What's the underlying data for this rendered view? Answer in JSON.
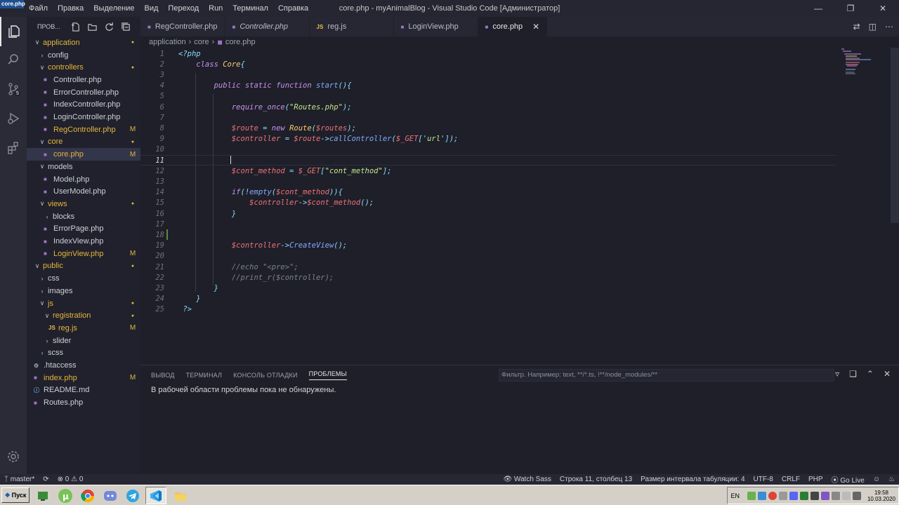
{
  "titlebar": {
    "badge": "core.php",
    "window_title": "core.php - myAnimalBlog - Visual Studio Code [Администратор]",
    "menu": [
      "Файл",
      "Правка",
      "Выделение",
      "Вид",
      "Переход",
      "Run",
      "Терминал",
      "Справка"
    ]
  },
  "sidebar": {
    "header": "ПРОВ...",
    "tree": [
      {
        "name": "application",
        "depth": 0,
        "chev": "v",
        "type": "folder",
        "status": "dot",
        "color": "mod"
      },
      {
        "name": "config",
        "depth": 1,
        "chev": ">",
        "type": "folder",
        "status": "",
        "color": "plain"
      },
      {
        "name": "controllers",
        "depth": 1,
        "chev": "v",
        "type": "folder",
        "status": "dot",
        "color": "mod"
      },
      {
        "name": "Controller.php",
        "depth": 2,
        "chev": "",
        "type": "php",
        "status": "",
        "color": "plain"
      },
      {
        "name": "ErrorController.php",
        "depth": 2,
        "chev": "",
        "type": "php",
        "status": "",
        "color": "plain"
      },
      {
        "name": "IndexController.php",
        "depth": 2,
        "chev": "",
        "type": "php",
        "status": "",
        "color": "plain"
      },
      {
        "name": "LoginController.php",
        "depth": 2,
        "chev": "",
        "type": "php",
        "status": "",
        "color": "plain"
      },
      {
        "name": "RegController.php",
        "depth": 2,
        "chev": "",
        "type": "php",
        "status": "M",
        "color": "mod"
      },
      {
        "name": "core",
        "depth": 1,
        "chev": "v",
        "type": "folder",
        "status": "dot",
        "color": "mod"
      },
      {
        "name": "core.php",
        "depth": 2,
        "chev": "",
        "type": "php",
        "status": "M",
        "color": "mod",
        "selected": true
      },
      {
        "name": "models",
        "depth": 1,
        "chev": "v",
        "type": "folder",
        "status": "",
        "color": "plain"
      },
      {
        "name": "Model.php",
        "depth": 2,
        "chev": "",
        "type": "php",
        "status": "",
        "color": "plain"
      },
      {
        "name": "UserModel.php",
        "depth": 2,
        "chev": "",
        "type": "php",
        "status": "",
        "color": "plain"
      },
      {
        "name": "views",
        "depth": 1,
        "chev": "v",
        "type": "folder",
        "status": "dot",
        "color": "mod"
      },
      {
        "name": "blocks",
        "depth": 2,
        "chev": ">",
        "type": "folder",
        "status": "",
        "color": "plain"
      },
      {
        "name": "ErrorPage.php",
        "depth": 2,
        "chev": "",
        "type": "php",
        "status": "",
        "color": "plain"
      },
      {
        "name": "IndexView.php",
        "depth": 2,
        "chev": "",
        "type": "php",
        "status": "",
        "color": "plain"
      },
      {
        "name": "LoginView.php",
        "depth": 2,
        "chev": "",
        "type": "php",
        "status": "M",
        "color": "mod"
      },
      {
        "name": "public",
        "depth": 0,
        "chev": "v",
        "type": "folder",
        "status": "dot",
        "color": "mod"
      },
      {
        "name": "css",
        "depth": 1,
        "chev": ">",
        "type": "folder",
        "status": "",
        "color": "plain"
      },
      {
        "name": "images",
        "depth": 1,
        "chev": ">",
        "type": "folder",
        "status": "",
        "color": "plain"
      },
      {
        "name": "js",
        "depth": 1,
        "chev": "v",
        "type": "folder",
        "status": "dot",
        "color": "mod"
      },
      {
        "name": "registration",
        "depth": 2,
        "chev": "v",
        "type": "folder",
        "status": "dot",
        "color": "mod"
      },
      {
        "name": "reg.js",
        "depth": 3,
        "chev": "",
        "type": "js",
        "status": "M",
        "color": "mod"
      },
      {
        "name": "slider",
        "depth": 2,
        "chev": ">",
        "type": "folder",
        "status": "",
        "color": "plain"
      },
      {
        "name": "scss",
        "depth": 1,
        "chev": ">",
        "type": "folder",
        "status": "",
        "color": "plain"
      },
      {
        "name": ".htaccess",
        "depth": 0,
        "chev": "",
        "type": "gear",
        "status": "",
        "color": "plain"
      },
      {
        "name": "index.php",
        "depth": 0,
        "chev": "",
        "type": "php",
        "status": "M",
        "color": "mod"
      },
      {
        "name": "README.md",
        "depth": 0,
        "chev": "",
        "type": "info",
        "status": "",
        "color": "plain"
      },
      {
        "name": "Routes.php",
        "depth": 0,
        "chev": "",
        "type": "php",
        "status": "",
        "color": "plain"
      }
    ]
  },
  "tabs": [
    {
      "label": "RegController.php",
      "type": "php",
      "italic": false
    },
    {
      "label": "Controller.php",
      "type": "php",
      "italic": true
    },
    {
      "label": "reg.js",
      "type": "js",
      "italic": false
    },
    {
      "label": "LoginView.php",
      "type": "php",
      "italic": false
    },
    {
      "label": "core.php",
      "type": "php",
      "italic": false,
      "active": true
    }
  ],
  "breadcrumb": [
    "application",
    "core",
    "core.php"
  ],
  "editor": {
    "current_line": 11,
    "lines": [
      [
        [
          "<?php",
          "punc"
        ]
      ],
      [
        [
          "    class ",
          "kw"
        ],
        [
          "Core",
          "cls"
        ],
        [
          "{",
          "punc"
        ]
      ],
      [],
      [
        [
          "        public static function ",
          "kw"
        ],
        [
          "start",
          "fn"
        ],
        [
          "(){",
          "punc"
        ]
      ],
      [],
      [
        [
          "            ",
          "def"
        ],
        [
          "require_once",
          "kw"
        ],
        [
          "(",
          "punc"
        ],
        [
          "\"Routes.php\"",
          "str"
        ],
        [
          ");",
          "punc"
        ]
      ],
      [],
      [
        [
          "            ",
          "def"
        ],
        [
          "$route",
          "var"
        ],
        [
          " = ",
          "punc"
        ],
        [
          "new ",
          "kw"
        ],
        [
          "Route",
          "cls"
        ],
        [
          "(",
          "punc"
        ],
        [
          "$routes",
          "var"
        ],
        [
          ");",
          "punc"
        ]
      ],
      [
        [
          "            ",
          "def"
        ],
        [
          "$controller",
          "var"
        ],
        [
          " = ",
          "punc"
        ],
        [
          "$route",
          "var"
        ],
        [
          "->",
          "punc"
        ],
        [
          "callController",
          "fn"
        ],
        [
          "(",
          "punc"
        ],
        [
          "$_GET",
          "var"
        ],
        [
          "['",
          "punc"
        ],
        [
          "url",
          "str"
        ],
        [
          "']",
          "punc"
        ],
        [
          ");",
          "punc"
        ]
      ],
      [],
      [],
      [
        [
          "            ",
          "def"
        ],
        [
          "$cont_method",
          "var"
        ],
        [
          " = ",
          "punc"
        ],
        [
          "$_GET",
          "var"
        ],
        [
          "[",
          "punc"
        ],
        [
          "\"cont_method\"",
          "str"
        ],
        [
          "];",
          "punc"
        ]
      ],
      [],
      [
        [
          "            ",
          "def"
        ],
        [
          "if",
          "kw"
        ],
        [
          "(!",
          "punc"
        ],
        [
          "empty",
          "fn"
        ],
        [
          "(",
          "punc"
        ],
        [
          "$cont_method",
          "var"
        ],
        [
          ")){",
          "punc"
        ]
      ],
      [
        [
          "                ",
          "def"
        ],
        [
          "$controller",
          "var"
        ],
        [
          "->",
          "punc"
        ],
        [
          "$cont_method",
          "var"
        ],
        [
          "();",
          "punc"
        ]
      ],
      [
        [
          "            ",
          "def"
        ],
        [
          "}",
          "punc"
        ]
      ],
      [],
      [],
      [
        [
          "            ",
          "def"
        ],
        [
          "$controller",
          "var"
        ],
        [
          "->",
          "punc"
        ],
        [
          "CreateView",
          "fn"
        ],
        [
          "();",
          "punc"
        ]
      ],
      [],
      [
        [
          "            ",
          "def"
        ],
        [
          "//echo \"<pre>\";",
          "cmt"
        ]
      ],
      [
        [
          "            ",
          "def"
        ],
        [
          "//print_r($controller);",
          "cmt"
        ]
      ],
      [
        [
          "        ",
          "def"
        ],
        [
          "}",
          "punc"
        ]
      ],
      [
        [
          "    ",
          "def"
        ],
        [
          "}",
          "punc"
        ]
      ],
      [
        [
          " ?>",
          "punc"
        ]
      ]
    ]
  },
  "panel": {
    "tabs": [
      "ВЫВОД",
      "ТЕРМИНАЛ",
      "КОНСОЛЬ ОТЛАДКИ",
      "ПРОБЛЕМЫ"
    ],
    "active_tab": 3,
    "filter_placeholder": "Фильтр. Например: text, **/*.ts, !**/node_modules/**",
    "message": "В рабочей области проблемы пока не обнаружены."
  },
  "statusbar": {
    "branch": "master*",
    "errors": "0",
    "warnings": "0",
    "watch_sass": "Watch Sass",
    "position": "Строка 11, столбец 13",
    "indent": "Размер интервала табуляции: 4",
    "encoding": "UTF-8",
    "eol": "CRLF",
    "language": "PHP",
    "golive": "Go Live"
  },
  "taskbar": {
    "start_label": "Пуск",
    "lang": "EN",
    "time": "19:58",
    "date": "10.03.2020"
  },
  "colors": {
    "accent_mod": "#e5b53c",
    "php_icon": "#a074c4",
    "js_icon": "#e5c04b"
  }
}
